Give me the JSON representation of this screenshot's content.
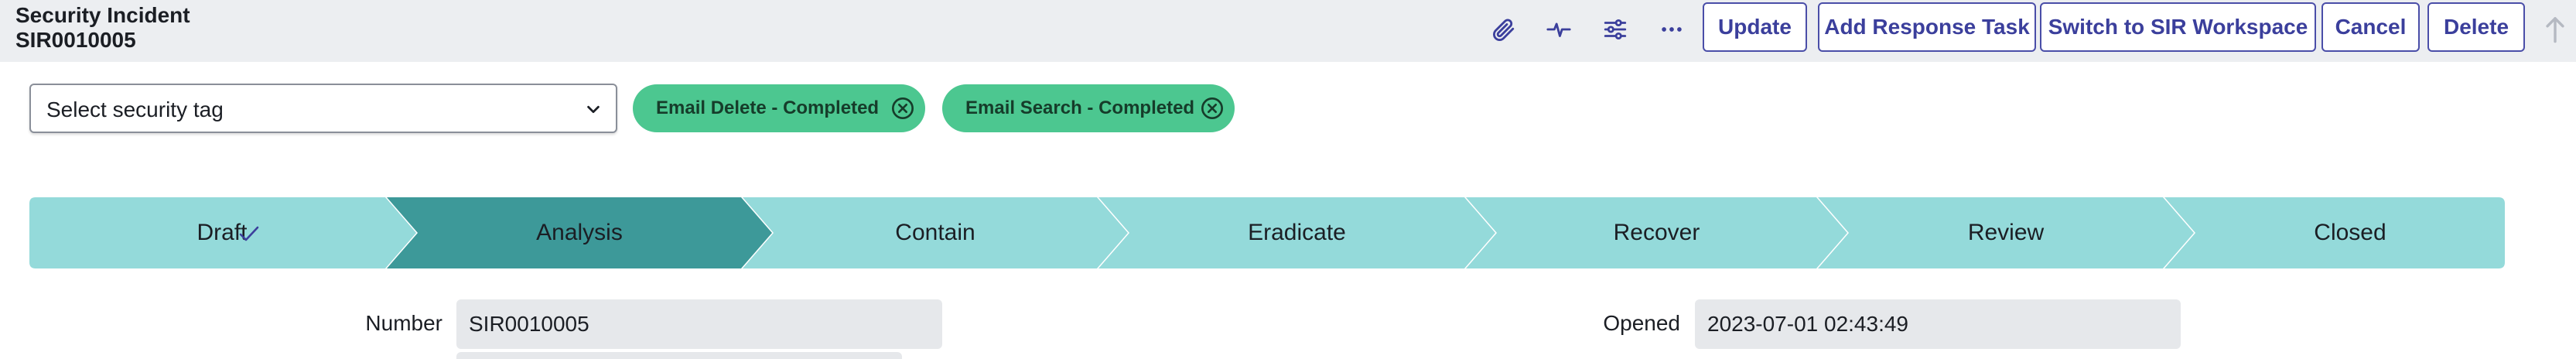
{
  "header": {
    "record_type": "Security Incident",
    "record_number": "SIR0010005",
    "icons": [
      "paperclip-icon",
      "activity-icon",
      "settings-sliders-icon",
      "more-options-icon",
      "scroll-up-icon"
    ],
    "buttons": {
      "update": "Update",
      "add_response_task": "Add Response Task",
      "switch_workspace": "Switch to SIR Workspace",
      "cancel": "Cancel",
      "delete": "Delete"
    }
  },
  "tags": {
    "select_label": "Select security tag",
    "chips": [
      {
        "label": "Email Delete - Completed"
      },
      {
        "label": "Email Search - Completed"
      }
    ]
  },
  "stages": {
    "items": [
      {
        "label": "Draft",
        "state": "completed"
      },
      {
        "label": "Analysis",
        "state": "current"
      },
      {
        "label": "Contain",
        "state": "pending"
      },
      {
        "label": "Eradicate",
        "state": "pending"
      },
      {
        "label": "Recover",
        "state": "pending"
      },
      {
        "label": "Review",
        "state": "pending"
      },
      {
        "label": "Closed",
        "state": "pending"
      }
    ]
  },
  "fields": {
    "number": {
      "label": "Number",
      "value": "SIR0010005"
    },
    "opened": {
      "label": "Opened",
      "value": "2023-07-01 02:43:49"
    }
  },
  "colors": {
    "header_bg": "#eceef1",
    "button_text": "#3b3f9c",
    "chip_bg": "#4cc790",
    "stage_pending": "#94dada",
    "stage_current": "#3d9999",
    "input_bg": "#e6e8eb"
  }
}
